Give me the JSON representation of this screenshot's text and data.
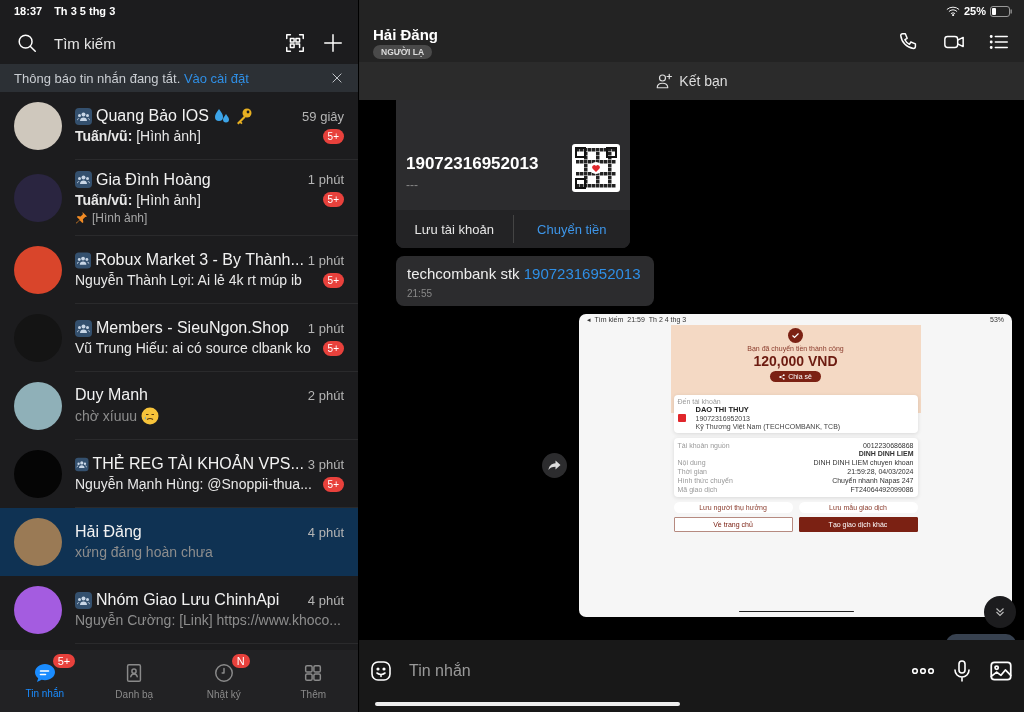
{
  "status_bar": {
    "time": "18:37",
    "date": "Th 3 5 thg 3",
    "battery": "25%"
  },
  "search": {
    "placeholder": "Tìm kiếm"
  },
  "notice": {
    "text": "Thông báo tin nhắn đang tắt.",
    "link": "Vào cài đặt"
  },
  "conversations": [
    {
      "name": "Quang Bảo IOS",
      "group": true,
      "time": "59 giây",
      "preview": "**Tuấn/vũ:** [Hình ảnh]",
      "unread": true,
      "badge": "5+",
      "selected": false
    },
    {
      "name": "Gia Đình Hoàng",
      "group": true,
      "time": "1 phút",
      "preview": "**Tuấn/vũ:** [Hình ảnh]",
      "pinned": "[Hình ảnh]",
      "unread": true,
      "badge": "5+",
      "selected": false
    },
    {
      "name": "Robux Market 3 - By Thành...",
      "group": true,
      "time": "1 phút",
      "preview": "Nguyễn Thành Lợi: Ai lẻ 4k rt múp ib",
      "unread": true,
      "badge": "5+",
      "selected": false
    },
    {
      "name": "Members - SieuNgon.Shop",
      "group": true,
      "time": "1 phút",
      "preview": "Vũ Trung Hiếu: ai có source clbank ko",
      "unread": true,
      "badge": "5+",
      "selected": false
    },
    {
      "name": "Duy Manh",
      "group": false,
      "time": "2 phút",
      "preview": "chờ xíuuu",
      "unread": false,
      "selected": false
    },
    {
      "name": "THẺ REG TÀI KHOẢN VPS...",
      "group": true,
      "time": "3 phút",
      "preview": "Nguyễn Mạnh Hùng: @Snoppii-thua...",
      "unread": true,
      "badge": "5+",
      "selected": false
    },
    {
      "name": "Hải Đăng",
      "group": false,
      "time": "4 phút",
      "preview": "xứng đáng hoàn chưa",
      "unread": false,
      "selected": true
    },
    {
      "name": "Nhóm Giao Lưu ChinhApi",
      "group": true,
      "time": "4 phút",
      "preview": "Nguyễn Cường: [Link] https://www.khoco...",
      "unread": false,
      "selected": false
    }
  ],
  "tabs": [
    {
      "label": "Tin nhắn",
      "selected": true,
      "badge": "5+"
    },
    {
      "label": "Danh bạ",
      "selected": false
    },
    {
      "label": "Nhật ký",
      "selected": false,
      "badge": "N"
    },
    {
      "label": "Thêm",
      "selected": false
    }
  ],
  "chat": {
    "name": "Hải Đăng",
    "tag": "NGƯỜI LẠ",
    "add_friend": "Kết bạn"
  },
  "messages": [
    {
      "kind": "account_card",
      "account": "19072316952013",
      "note": "---",
      "actions": [
        "Lưu tài khoản",
        "Chuyển tiền"
      ]
    },
    {
      "kind": "text",
      "text": "techcombank stk ",
      "link": "19072316952013",
      "time": "21:55"
    },
    {
      "kind": "image",
      "screenshot": {
        "status_back": "◂",
        "status_left": "Tìm kiếm",
        "status_time": "21:59",
        "status_date": "Th 2 4 thg 3",
        "status_battery": "53%",
        "success": "Bạn đã chuyển tiền thành công",
        "amount": "120,000 VND",
        "share": "Chia sẻ",
        "to_label": "Đến tài khoản",
        "recipient": "DAO THI THUY",
        "recipient_account": "19072316952013",
        "bank": "Kỹ Thương Việt Nam (TECHCOMBANK, TCB)",
        "details": [
          {
            "label": "Tài khoản nguồn",
            "value": "0012230686868",
            "value2": "DINH DINH LIEM"
          },
          {
            "label": "Nội dung",
            "value": "DINH DINH LIEM chuyen khoan"
          },
          {
            "label": "Thời gian",
            "value": "21:59:28, 04/03/2024"
          },
          {
            "label": "Hình thức chuyển",
            "value": "Chuyển nhanh Napas 247"
          },
          {
            "label": "Mã giao dịch",
            "value": "FT24064492099086"
          }
        ],
        "save_actions": [
          "Lưu người thụ hưởng",
          "Lưu mẫu giao dịch"
        ],
        "buttons": [
          "Về trang chủ",
          "Tạo giao dịch khác"
        ]
      }
    },
    {
      "kind": "outgoing_partial"
    }
  ],
  "input": {
    "placeholder": "Tin nhắn"
  }
}
